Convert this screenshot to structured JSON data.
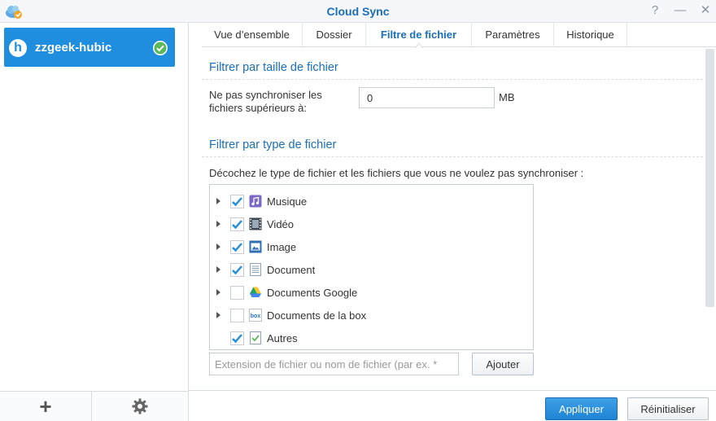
{
  "window": {
    "title": "Cloud Sync",
    "help_glyph": "?",
    "minimize_glyph": "—",
    "close_glyph": "✕"
  },
  "sidebar": {
    "account": {
      "name": "zzgeek-hubic",
      "logo_letter": "h",
      "status": "synced"
    },
    "footer": {
      "add_glyph": "+",
      "settings_icon": "gear-icon"
    }
  },
  "tabs": [
    {
      "label": "Vue d’ensemble",
      "active": false
    },
    {
      "label": "Dossier",
      "active": false
    },
    {
      "label": "Filtre de fichier",
      "active": true
    },
    {
      "label": "Paramètres",
      "active": false
    },
    {
      "label": "Historique",
      "active": false
    }
  ],
  "size_filter": {
    "title": "Filtrer par taille de fichier",
    "label": "Ne pas synchroniser les fichiers supérieurs à:",
    "value": "0",
    "unit": "MB"
  },
  "type_filter": {
    "title": "Filtrer par type de fichier",
    "description": "Décochez le type de fichier et les fichiers que vous ne voulez pas synchroniser :",
    "items": [
      {
        "label": "Musique",
        "checked": true,
        "expandable": true,
        "icon": "music-icon"
      },
      {
        "label": "Vidéo",
        "checked": true,
        "expandable": true,
        "icon": "video-icon"
      },
      {
        "label": "Image",
        "checked": true,
        "expandable": true,
        "icon": "image-icon"
      },
      {
        "label": "Document",
        "checked": true,
        "expandable": true,
        "icon": "document-icon"
      },
      {
        "label": "Documents Google",
        "checked": false,
        "expandable": true,
        "icon": "google-drive-icon"
      },
      {
        "label": "Documents de la box",
        "checked": false,
        "expandable": true,
        "icon": "box-icon"
      },
      {
        "label": "Autres",
        "checked": true,
        "expandable": false,
        "icon": "other-files-icon"
      }
    ],
    "extension_placeholder": "Extension de fichier ou nom de fichier (par ex. *",
    "add_label": "Ajouter"
  },
  "footer": {
    "apply_label": "Appliquer",
    "reset_label": "Réinitialiser"
  },
  "colors": {
    "accent": "#1a6fb8",
    "sidebar_selected": "#1f8ede",
    "check": "#1f8ede",
    "status_ok": "#5cb85c"
  }
}
